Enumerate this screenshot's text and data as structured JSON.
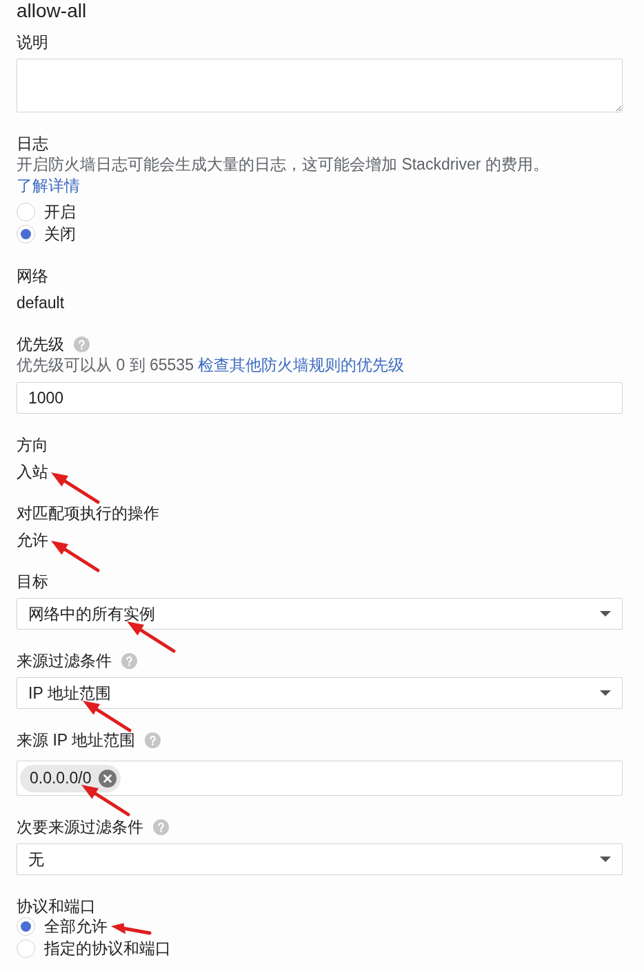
{
  "rule_name": "allow-all",
  "sections": [
    {
      "kind": "textarea",
      "label": "说明"
    },
    {
      "kind": "radio",
      "label": "日志",
      "description": "开启防火墙日志可能会生成大量的日志，这可能会增加 Stackdriver 的费用。",
      "link": "了解详情",
      "options": [
        {
          "label": "开启",
          "selected": false
        },
        {
          "label": "关闭",
          "selected": true
        }
      ]
    },
    {
      "kind": "static",
      "label": "网络",
      "value": "default"
    },
    {
      "kind": "input",
      "label": "优先级",
      "help": true,
      "description": "优先级可以从 0 到 65535",
      "link": "检查其他防火墙规则的优先级",
      "value": "1000"
    },
    {
      "kind": "static",
      "label": "方向",
      "value": "入站",
      "arrow": true
    },
    {
      "kind": "static",
      "label": "对匹配项执行的操作",
      "value": "允许",
      "arrow": true
    },
    {
      "kind": "select",
      "label": "目标",
      "value": "网络中的所有实例",
      "arrow": true
    },
    {
      "kind": "select",
      "label": "来源过滤条件",
      "help": true,
      "value": "IP 地址范围",
      "arrow": true
    },
    {
      "kind": "chips",
      "label": "来源 IP 地址范围",
      "help": true,
      "chips": [
        {
          "text": "0.0.0.0/0",
          "arrow": true
        }
      ]
    },
    {
      "kind": "select",
      "label": "次要来源过滤条件",
      "help": true,
      "value": "无"
    },
    {
      "kind": "radio",
      "label": "协议和端口",
      "options": [
        {
          "label": "全部允许",
          "selected": true,
          "arrow": true
        },
        {
          "label": "指定的协议和端口",
          "selected": false
        }
      ]
    }
  ]
}
